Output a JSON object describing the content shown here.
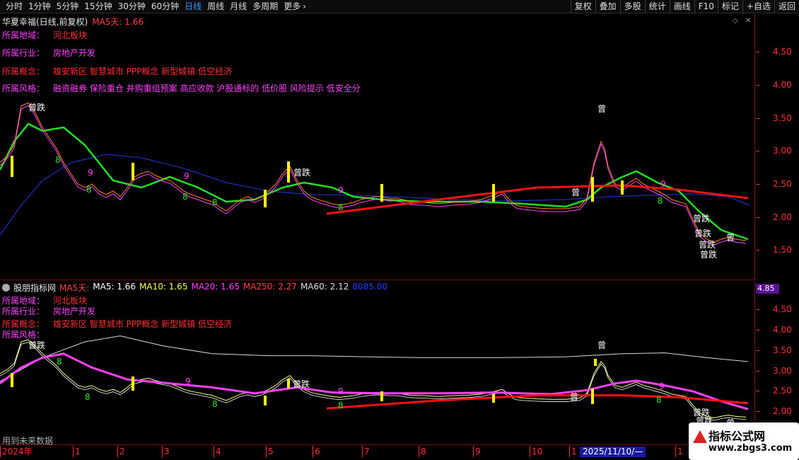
{
  "toolbar": {
    "periods": [
      "分时",
      "1分钟",
      "5分钟",
      "15分钟",
      "30分钟",
      "60分钟",
      "日线",
      "周线",
      "月线",
      "多周期",
      "更多"
    ],
    "active_index": 6,
    "right_buttons": [
      "复权",
      "叠加",
      "多股",
      "统计",
      "画线",
      "F10",
      "标记",
      "+自选",
      "返回"
    ]
  },
  "top_panel": {
    "title": "华夏幸福(日线,前复权)",
    "ma5": "MA5天: 1.66",
    "info": [
      {
        "key": "所属地域：",
        "value": "河北板块"
      },
      {
        "key": "所属行业：",
        "value": "房地产开发"
      },
      {
        "key": "所属概念：",
        "value": "雄安新区 智慧城市 PPP概念 新型城镇 低空经济"
      },
      {
        "key": "所属风格：",
        "value": "融资融券 保险重仓 并购重组预案 高应收款 沪股通标的 低价股 风险提示 低安全分"
      }
    ],
    "axis_ticks": [
      "4.50",
      "4.00",
      "3.50",
      "3.00",
      "2.50",
      "2.00",
      "1.50"
    ]
  },
  "bottom_panel": {
    "indicator_name": "股朋指标网",
    "ma_values": [
      {
        "label": "MA5天:",
        "value": "",
        "color": "#ff4040"
      },
      {
        "label": "MA5:",
        "value": "1.66",
        "color": "#ffffff"
      },
      {
        "label": "MA10:",
        "value": "1.65",
        "color": "#ffff40"
      },
      {
        "label": "MA20:",
        "value": "1.65",
        "color": "#ff40ff"
      },
      {
        "label": "MA250:",
        "value": "2.27",
        "color": "#ff4040"
      },
      {
        "label": "MA60:",
        "value": "2.12",
        "color": "#e0e0e0"
      },
      {
        "label": "",
        "value": "8085.00",
        "color": "#2040ff"
      }
    ],
    "info": [
      {
        "key": "所属地域：",
        "value": "河北板块"
      },
      {
        "key": "所属行业：",
        "value": "房地产开发"
      },
      {
        "key": "所属概念：",
        "value": "雄安新区 智慧城市 PPP概念 新型城镇 低空经济"
      },
      {
        "key": "所属风格：",
        "value": ""
      }
    ],
    "axis_badge": "4.85",
    "axis_ticks": [
      "4.50",
      "4.00",
      "3.50",
      "3.00",
      "2.50",
      "2.00"
    ]
  },
  "chart_labels": {
    "zeng": "曾",
    "zeng_die": "曾跌",
    "nine": "9",
    "eight": "8"
  },
  "xaxis": {
    "labels": [
      "2024年",
      "1",
      "2",
      "3",
      "4",
      "5",
      "6",
      "7",
      "8",
      "9",
      "10",
      "1",
      "1"
    ],
    "cursor_date": "2025/11/10/—"
  },
  "footer": {
    "future_note": "用到未来数据"
  },
  "watermark": {
    "title": "指标公式网",
    "url": "www.zbgs3.com"
  },
  "colors": {
    "ma_green": "#20e020",
    "ma_blue": "#1a2fb0",
    "trend_red": "#ff1010",
    "ma_magenta": "#ff40ff",
    "price_orange": "#ff8020",
    "signal_yellow": "#ffff00"
  }
}
